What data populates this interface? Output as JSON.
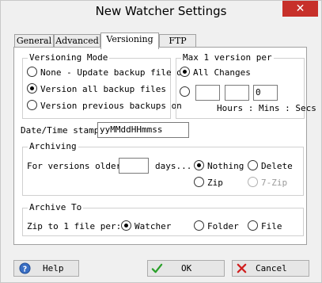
{
  "window": {
    "title": "New Watcher Settings",
    "close_glyph": "✕"
  },
  "tabs": [
    {
      "label": "General"
    },
    {
      "label": "Advanced"
    },
    {
      "label": "Versioning",
      "active": true
    },
    {
      "label": "FTP"
    }
  ],
  "versioning_mode": {
    "label": "Versioning Mode",
    "options": [
      {
        "label": "None - Update backup file o",
        "checked": false
      },
      {
        "label": "Version all backup files",
        "checked": true
      },
      {
        "label": "Version previous backups on",
        "checked": false
      }
    ]
  },
  "max_version": {
    "label": "Max 1 version per",
    "all_changes_label": "All Changes",
    "all_changes_checked": true,
    "custom_checked": false,
    "hours_value": "",
    "mins_value": "",
    "secs_value": "0",
    "units_label": "Hours : Mins : Secs"
  },
  "datetime_stamp": {
    "label": "Date/Time stamp:",
    "value": "yyMMddHHmmss"
  },
  "archiving": {
    "label": "Archiving",
    "prefix_label": "For versions older than",
    "days_value": "",
    "days_label": "days...",
    "options": [
      {
        "label": "Nothing",
        "checked": true,
        "enabled": true
      },
      {
        "label": "Delete",
        "checked": false,
        "enabled": true
      },
      {
        "label": "Zip",
        "checked": false,
        "enabled": true
      },
      {
        "label": "7-Zip",
        "checked": false,
        "enabled": false
      }
    ]
  },
  "archive_to": {
    "label": "Archive To",
    "prefix_label": "Zip to 1 file per:",
    "options": [
      {
        "label": "Watcher",
        "checked": true
      },
      {
        "label": "Folder",
        "checked": false
      },
      {
        "label": "File",
        "checked": false
      }
    ]
  },
  "buttons": {
    "help": {
      "label": "Help",
      "icon": "help-icon"
    },
    "ok": {
      "label": "OK",
      "icon": "checkmark-icon"
    },
    "cancel": {
      "label": "Cancel",
      "icon": "cancel-x-icon"
    }
  },
  "colors": {
    "close_button": "#c7302a",
    "ok_check": "#2aa02a",
    "cancel_x": "#d02020",
    "help_icon": "#3a6fc4"
  }
}
